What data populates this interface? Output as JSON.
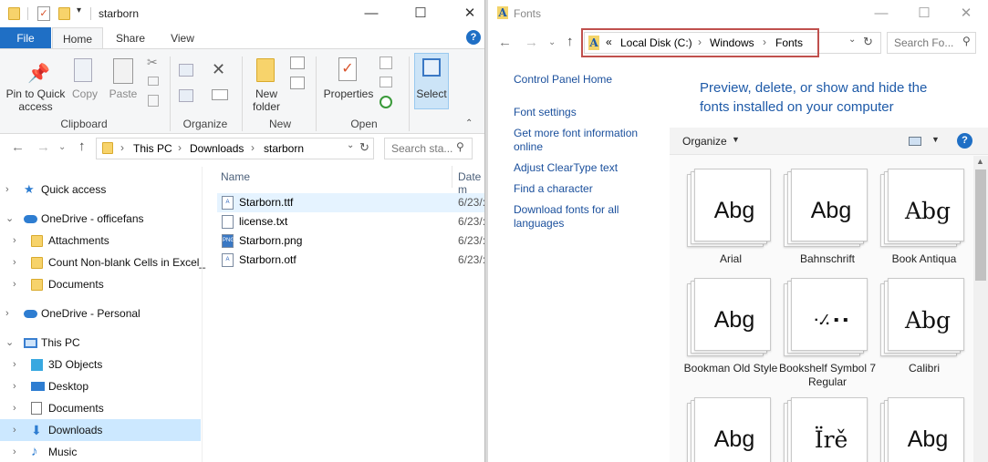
{
  "left_window": {
    "title": "starborn",
    "ribbon_tabs": [
      "File",
      "Home",
      "Share",
      "View"
    ],
    "ribbon": {
      "pin_label": "Pin to Quick access",
      "copy_label": "Copy",
      "paste_label": "Paste",
      "newfolder_label": "New folder",
      "properties_label": "Properties",
      "select_label": "Select",
      "groups": [
        "Clipboard",
        "Organize",
        "New",
        "Open"
      ]
    },
    "breadcrumb": [
      "This PC",
      "Downloads",
      "starborn"
    ],
    "search_placeholder": "Search sta...",
    "nav_tree": [
      {
        "label": "Quick access",
        "icon": "star-icon",
        "chev": "›"
      },
      {
        "label": "OneDrive - officefans",
        "icon": "cloud-icon",
        "chev": "⌄"
      },
      {
        "label": "Attachments",
        "icon": "folder-icon",
        "chev": "›"
      },
      {
        "label": "Count Non-blank Cells in Excel_",
        "icon": "folder-icon",
        "chev": "›"
      },
      {
        "label": "Documents",
        "icon": "folder-icon",
        "chev": "›"
      },
      {
        "label": "OneDrive - Personal",
        "icon": "cloud-icon",
        "chev": "›"
      },
      {
        "label": "This PC",
        "icon": "pc-icon",
        "chev": "⌄"
      },
      {
        "label": "3D Objects",
        "icon": "cube-icon",
        "chev": "›"
      },
      {
        "label": "Desktop",
        "icon": "desktop-icon",
        "chev": "›"
      },
      {
        "label": "Documents",
        "icon": "document-icon",
        "chev": "›"
      },
      {
        "label": "Downloads",
        "icon": "download-icon",
        "chev": "›"
      },
      {
        "label": "Music",
        "icon": "music-icon",
        "chev": "›"
      }
    ],
    "columns": {
      "name": "Name",
      "date": "Date m"
    },
    "files": [
      {
        "name": "Starborn.ttf",
        "date": "6/23/:",
        "icon": "font-file-icon"
      },
      {
        "name": "license.txt",
        "date": "6/23/:",
        "icon": "text-file-icon"
      },
      {
        "name": "Starborn.png",
        "date": "6/23/:",
        "icon": "image-file-icon"
      },
      {
        "name": "Starborn.otf",
        "date": "6/23/:",
        "icon": "font-file-icon"
      }
    ]
  },
  "right_window": {
    "title": "Fonts",
    "breadcrumb_prefix": "«",
    "breadcrumb": [
      "Local Disk (C:)",
      "Windows",
      "Fonts"
    ],
    "search_placeholder": "Search Fo...",
    "side_links": {
      "home": "Control Panel Home",
      "settings": "Font settings",
      "more_info": "Get more font information online",
      "cleartype": "Adjust ClearType text",
      "find_char": "Find a character",
      "download": "Download fonts for all languages"
    },
    "heading": "Preview, delete, or show and hide the fonts installed on your computer",
    "organize_label": "Organize",
    "fonts": [
      {
        "name": "Arial",
        "sample": "Abg"
      },
      {
        "name": "Bahnschrift",
        "sample": "Abg"
      },
      {
        "name": "Book Antiqua",
        "sample": "Abg"
      },
      {
        "name": "Bookman Old Style",
        "sample": "Abg"
      },
      {
        "name": "Bookshelf Symbol 7 Regular",
        "sample": "·.⁄. ▪ ▪"
      },
      {
        "name": "Calibri",
        "sample": "Abg"
      },
      {
        "name": "",
        "sample": "Abg"
      },
      {
        "name": "",
        "sample": "Ïrě"
      },
      {
        "name": "",
        "sample": "Abg"
      }
    ],
    "colors": {
      "link": "#1a4f9c",
      "heading": "#1e5aa8",
      "highlight_border": "#c0504d"
    }
  }
}
